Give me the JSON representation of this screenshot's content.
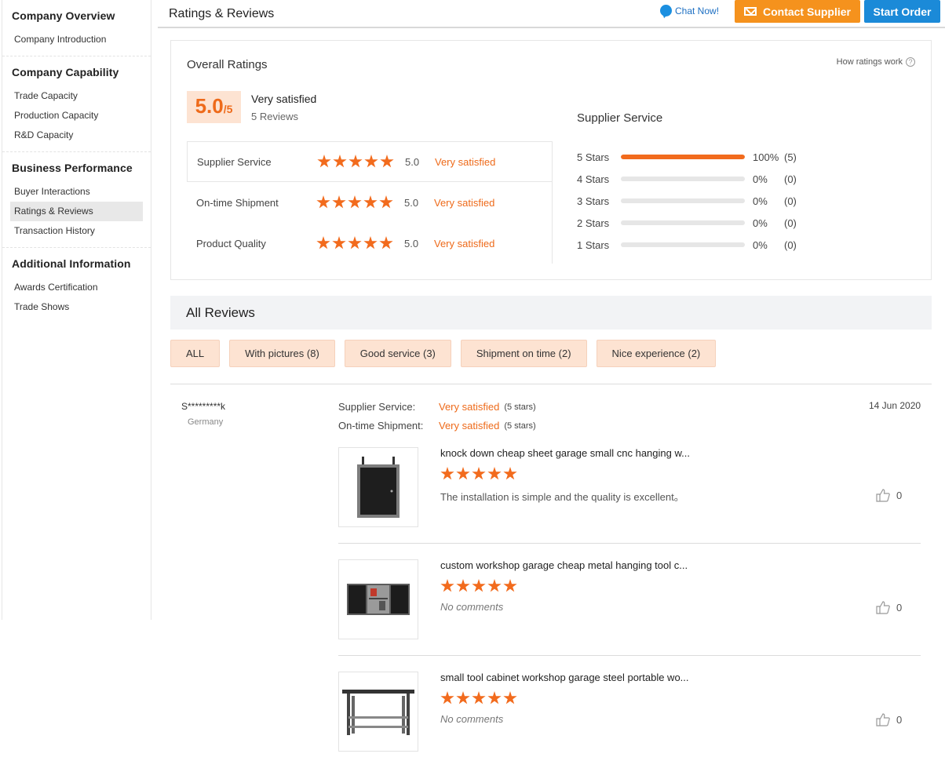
{
  "sidebar": {
    "sections": [
      {
        "title": "Company Overview",
        "items": [
          "Company Introduction"
        ]
      },
      {
        "title": "Company Capability",
        "items": [
          "Trade Capacity",
          "Production Capacity",
          "R&D Capacity"
        ]
      },
      {
        "title": "Business Performance",
        "items": [
          "Buyer Interactions",
          "Ratings & Reviews",
          "Transaction History"
        ]
      },
      {
        "title": "Additional Information",
        "items": [
          "Awards Certification",
          "Trade Shows"
        ]
      }
    ],
    "active_item": "Ratings & Reviews"
  },
  "header": {
    "title": "Ratings & Reviews",
    "chat_now": "Chat Now!",
    "contact_supplier": "Contact Supplier",
    "start_order": "Start Order"
  },
  "overall": {
    "title": "Overall Ratings",
    "how_ratings": "How ratings work",
    "score": "5.0",
    "score_max": "/5",
    "satisfaction": "Very satisfied",
    "review_count": "5 Reviews",
    "categories": [
      {
        "label": "Supplier Service",
        "stars": 5,
        "score": "5.0",
        "satisfaction": "Very satisfied"
      },
      {
        "label": "On-time Shipment",
        "stars": 5,
        "score": "5.0",
        "satisfaction": "Very satisfied"
      },
      {
        "label": "Product Quality",
        "stars": 5,
        "score": "5.0",
        "satisfaction": "Very satisfied"
      }
    ]
  },
  "supplier_service": {
    "title": "Supplier Service",
    "distribution": [
      {
        "label": "5  Stars",
        "fraction": 1.0,
        "pct": "100%",
        "count": "(5)"
      },
      {
        "label": "4  Stars",
        "fraction": 0,
        "pct": "0%",
        "count": "(0)"
      },
      {
        "label": "3  Stars",
        "fraction": 0,
        "pct": "0%",
        "count": "(0)"
      },
      {
        "label": "2  Stars",
        "fraction": 0,
        "pct": "0%",
        "count": "(0)"
      },
      {
        "label": "1  Stars",
        "fraction": 0,
        "pct": "0%",
        "count": "(0)"
      }
    ]
  },
  "all_reviews": {
    "title": "All Reviews",
    "filters": [
      "ALL",
      "With pictures (8)",
      "Good service (3)",
      "Shipment on time (2)",
      "Nice experience (2)"
    ]
  },
  "review": {
    "reviewer": "S*********k",
    "country": "Germany",
    "date": "14 Jun 2020",
    "meta": [
      {
        "key": "Supplier Service:",
        "value": "Very satisfied",
        "stars": "(5 stars)"
      },
      {
        "key": "On-time Shipment:",
        "value": "Very satisfied",
        "stars": "(5 stars)"
      }
    ],
    "products": [
      {
        "name": "knock down cheap sheet garage small cnc hanging w...",
        "stars": 5,
        "comment": "The installation is simple and the quality is excellent。",
        "likes": "0",
        "image": "hanging-cabinet"
      },
      {
        "name": "custom workshop garage cheap metal hanging tool c...",
        "stars": 5,
        "comment": "No comments",
        "likes": "0",
        "image": "wall-tool-cabinet"
      },
      {
        "name": "small tool cabinet workshop garage steel portable wo...",
        "stars": 5,
        "comment": "No comments",
        "likes": "0",
        "image": "workbench"
      }
    ]
  },
  "colors": {
    "accent_orange": "#f26b1d",
    "contact_button": "#f5921d",
    "start_button": "#1b8ad8",
    "badge_bg": "#fde3d2"
  }
}
